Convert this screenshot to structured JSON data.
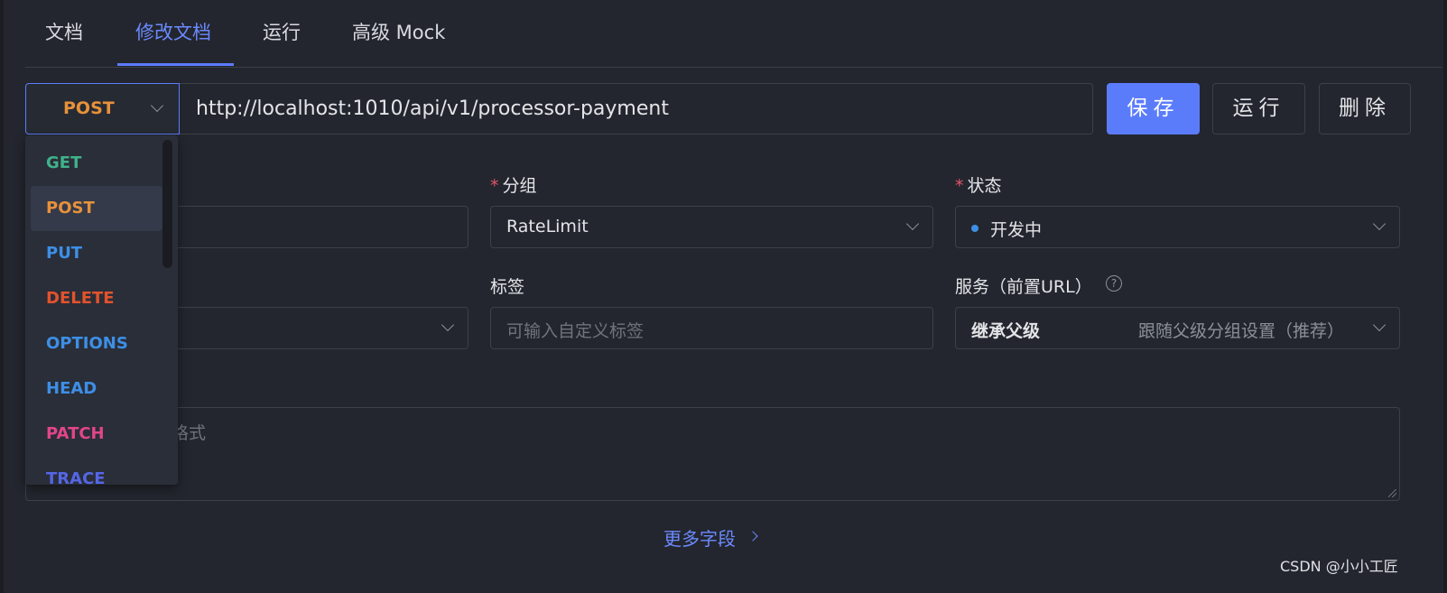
{
  "tabs": [
    {
      "label": "文档"
    },
    {
      "label": "修改文档"
    },
    {
      "label": "运行"
    },
    {
      "label": "高级 Mock"
    }
  ],
  "request": {
    "method": "POST",
    "url": "http://localhost:1010/api/v1/processor-payment"
  },
  "buttons": {
    "save": "保存",
    "run": "运行",
    "delete": "删除"
  },
  "form": {
    "group": {
      "label": "分组",
      "value": "RateLimit"
    },
    "status": {
      "label": "状态",
      "value": "开发中",
      "dot_color": "#3d8fe6"
    },
    "tags": {
      "label": "标签",
      "placeholder": "可输入自定义标签"
    },
    "service": {
      "label": "服务（前置URL）",
      "value": "继承父级",
      "hint": "跟随父级分组设置（推荐）"
    },
    "description": {
      "placeholder_fragment": "格式"
    }
  },
  "more_fields": "更多字段",
  "watermark": "CSDN @小小工匠",
  "method_options": [
    {
      "label": "GET",
      "color": "#3fb28a"
    },
    {
      "label": "POST",
      "color": "#e8913a"
    },
    {
      "label": "PUT",
      "color": "#3d8fe6"
    },
    {
      "label": "DELETE",
      "color": "#e2532d"
    },
    {
      "label": "OPTIONS",
      "color": "#3d8fe6"
    },
    {
      "label": "HEAD",
      "color": "#3d8fe6"
    },
    {
      "label": "PATCH",
      "color": "#e2458a"
    },
    {
      "label": "TRACE",
      "color": "#5566e6"
    }
  ],
  "colors": {
    "accent": "#5b7cfa",
    "background": "#23262e"
  }
}
